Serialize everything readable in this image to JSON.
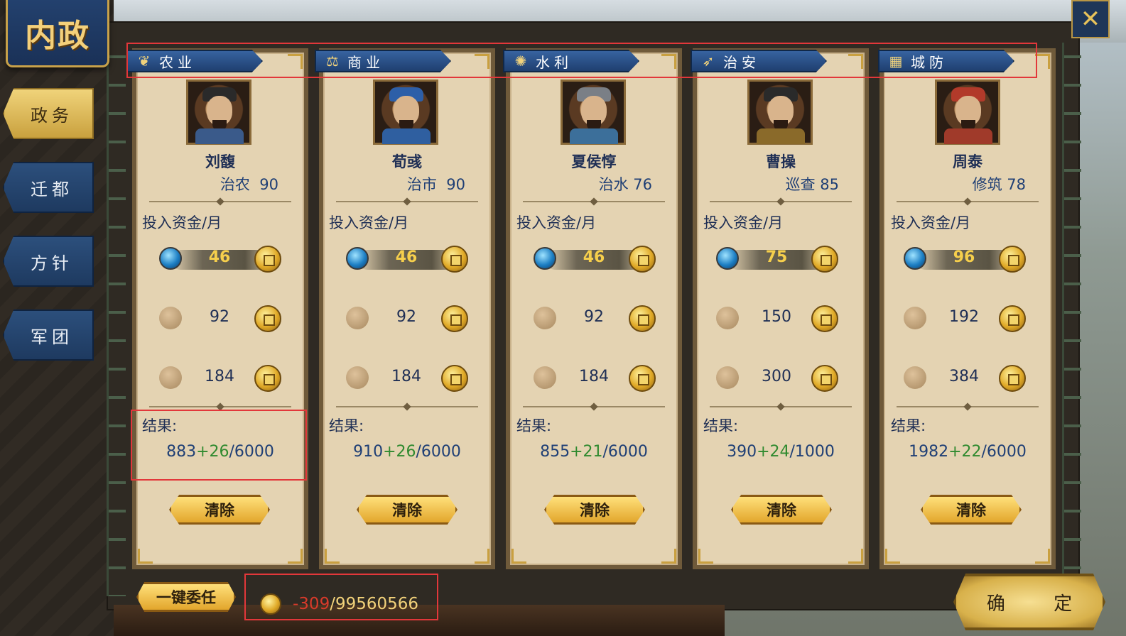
{
  "title": "内政",
  "sidebar": {
    "items": [
      {
        "label": "政务",
        "active": true
      },
      {
        "label": "迁都",
        "active": false
      },
      {
        "label": "方针",
        "active": false
      },
      {
        "label": "军团",
        "active": false
      }
    ]
  },
  "close_icon": "close-icon",
  "invest_label": "投入资金/月",
  "result_label": "结果:",
  "clear_label": "清除",
  "panels": [
    {
      "category": "农业",
      "icon": "wheat-icon",
      "general": "刘馥",
      "skill": "治农",
      "skill_value": "90",
      "slider_value": "46",
      "options": [
        "92",
        "184"
      ],
      "result_base": "883",
      "result_inc": "+26",
      "result_cap": "/6000",
      "portrait_color": "#3a5a8a"
    },
    {
      "category": "商业",
      "icon": "scale-icon",
      "general": "荀彧",
      "skill": "治市",
      "skill_value": "90",
      "slider_value": "46",
      "options": [
        "92",
        "184"
      ],
      "result_base": "910",
      "result_inc": "+26",
      "result_cap": "/6000",
      "portrait_color": "#2f5fa0"
    },
    {
      "category": "水利",
      "icon": "waterwheel-icon",
      "general": "夏侯惇",
      "skill": "治水",
      "skill_value": "76",
      "slider_value": "46",
      "options": [
        "92",
        "184"
      ],
      "result_base": "855",
      "result_inc": "+21",
      "result_cap": "/6000",
      "portrait_color": "#3c6f9a"
    },
    {
      "category": "治安",
      "icon": "horn-icon",
      "general": "曹操",
      "skill": "巡查",
      "skill_value": "85",
      "slider_value": "75",
      "options": [
        "150",
        "300"
      ],
      "result_base": "390",
      "result_inc": "+24",
      "result_cap": "/1000",
      "portrait_color": "#8a6a2a"
    },
    {
      "category": "城防",
      "icon": "wall-icon",
      "general": "周泰",
      "skill": "修筑",
      "skill_value": "78",
      "slider_value": "96",
      "options": [
        "192",
        "384"
      ],
      "result_base": "1982",
      "result_inc": "+22",
      "result_cap": "/6000",
      "portrait_color": "#a03a2a"
    }
  ],
  "footer": {
    "delegate_label": "一键委任",
    "funds_change": "-309",
    "funds_total": "/99560566",
    "confirm_label": "确 定"
  },
  "colors": {
    "panel_bg": "#e4d3b2",
    "header_blue": "#1f3f70",
    "slider_value": "#f6cf4c",
    "increment_green": "#2f8a2f",
    "negative_red": "#d83a2a",
    "button_gold": "#e2a62c"
  }
}
